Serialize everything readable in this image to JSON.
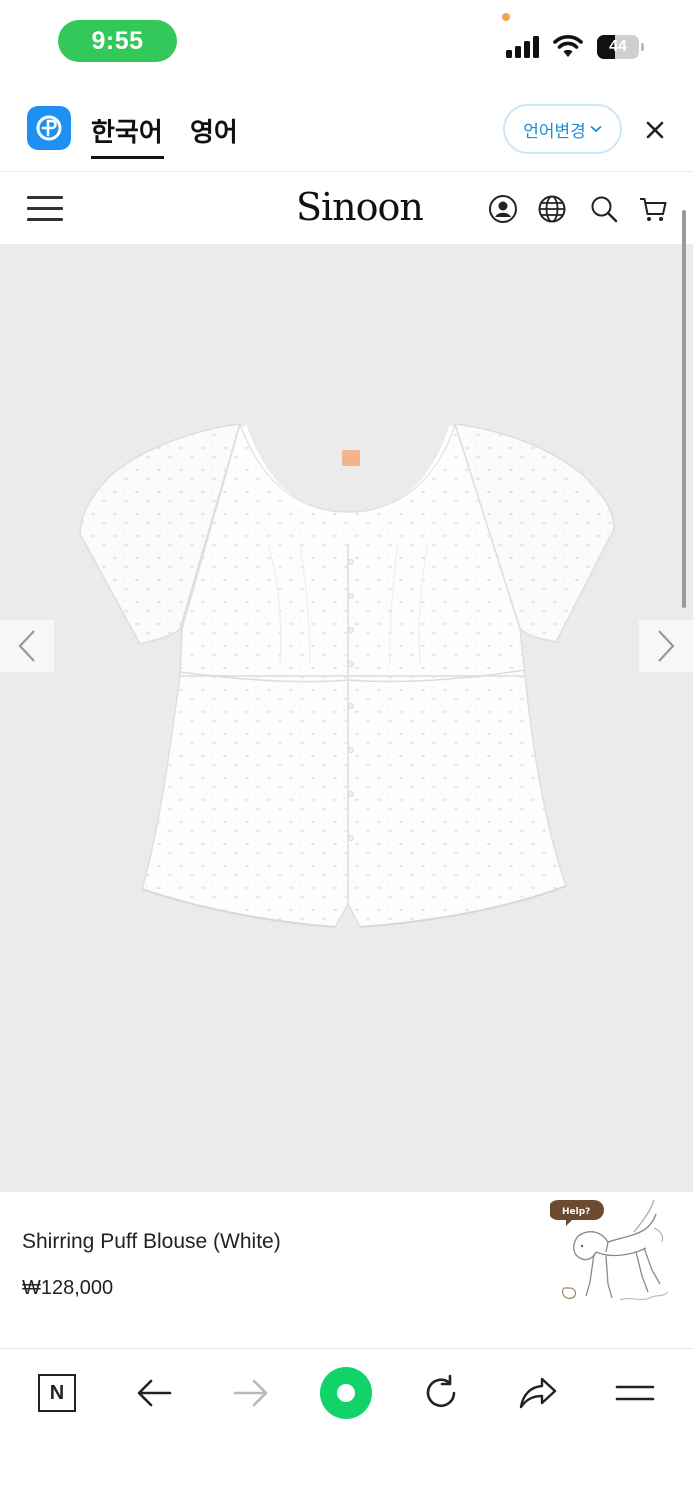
{
  "status_bar": {
    "time": "9:55",
    "battery_level": "44",
    "battery_fraction": 0.44,
    "colors": {
      "time_pill": "#34c759",
      "privacy_dot": "#f0a24a"
    }
  },
  "translate_bar": {
    "app_icon": "papago-translate-icon",
    "tabs": [
      {
        "label": "한국어",
        "active": true
      },
      {
        "label": "영어",
        "active": false
      }
    ],
    "language_change_label": "언어변경",
    "close_icon": "close-icon",
    "accent_color": "#1c8fd6"
  },
  "site_header": {
    "logo": "Sinoon",
    "icons": [
      "menu-icon",
      "account-icon",
      "globe-icon",
      "search-icon",
      "cart-icon"
    ]
  },
  "product": {
    "name": "Shirring Puff Blouse (White)",
    "price": "₩128,000",
    "image": "white-eyelet-puff-sleeve-blouse"
  },
  "help_widget": {
    "bubble_text": "Help?",
    "icon": "pony-illustration"
  },
  "browser_toolbar": {
    "home_label": "N",
    "icons": [
      "naver-home-icon",
      "back-icon",
      "forward-icon",
      "green-dot-icon",
      "reload-icon",
      "share-icon",
      "menu-icon"
    ],
    "accent_color": "#11d36a"
  }
}
